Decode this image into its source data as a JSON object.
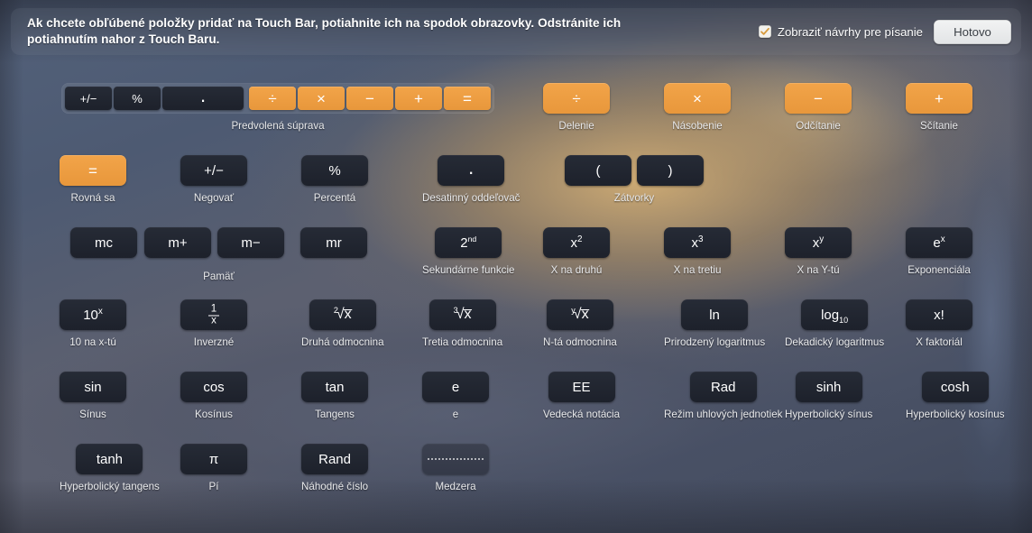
{
  "header": {
    "instruction": "Ak chcete obľúbené položky pridať na Touch Bar, potiahnite ich na spodok obrazovky. Odstránite ich potiahnutím nahor z Touch Baru.",
    "checkbox_label": "Zobraziť návrhy pre písanie",
    "checkbox_checked": true,
    "done_label": "Hotovo"
  },
  "colors": {
    "accent_orange": "#ee9d41",
    "key_dark": "#20252f",
    "caption": "#e9eaec",
    "panel": "rgba(255,255,255,0.055)"
  },
  "default_set": {
    "caption": "Predvolená súprava",
    "dark_keys": [
      {
        "glyph": "+/−",
        "name": "negate"
      },
      {
        "glyph": "%",
        "name": "percent"
      },
      {
        "glyph": ".",
        "name": "decimal-separator"
      }
    ],
    "orange_keys": [
      {
        "glyph": "÷",
        "name": "divide"
      },
      {
        "glyph": "×",
        "name": "multiply"
      },
      {
        "glyph": "−",
        "name": "subtract"
      },
      {
        "glyph": "+",
        "name": "add"
      },
      {
        "glyph": "=",
        "name": "equals"
      }
    ]
  },
  "rows": [
    {
      "id": "row-1",
      "items": [
        {
          "type": "tray",
          "name": "default-set",
          "caption": "Predvolená súprava"
        },
        {
          "type": "key",
          "name": "divide",
          "glyph": "÷",
          "caption": "Delenie",
          "style": "orange"
        },
        {
          "type": "key",
          "name": "multiply",
          "glyph": "×",
          "caption": "Násobenie",
          "style": "orange"
        },
        {
          "type": "key",
          "name": "subtract",
          "glyph": "−",
          "caption": "Odčítanie",
          "style": "orange"
        },
        {
          "type": "key",
          "name": "add",
          "glyph": "+",
          "caption": "Sčítanie",
          "style": "orange"
        }
      ]
    },
    {
      "id": "row-2",
      "items": [
        {
          "type": "key",
          "name": "equals",
          "glyph": "=",
          "caption": "Rovná sa",
          "style": "orange"
        },
        {
          "type": "key",
          "name": "negate",
          "glyph": "+/−",
          "caption": "Negovať",
          "style": "dark"
        },
        {
          "type": "key",
          "name": "percent",
          "glyph": "%",
          "caption": "Percentá",
          "style": "dark"
        },
        {
          "type": "key",
          "name": "decimal-separator",
          "glyph": ".",
          "caption": "Desatinný oddeľovač",
          "style": "dark"
        },
        {
          "type": "pair",
          "name": "parentheses",
          "glyphs": [
            "(",
            ")"
          ],
          "caption": "Zátvorky",
          "style": "dark"
        }
      ]
    },
    {
      "id": "row-3",
      "items": [
        {
          "type": "key",
          "name": "memory-clear",
          "glyph": "mc",
          "caption": "",
          "style": "dark"
        },
        {
          "type": "key",
          "name": "memory-add",
          "glyph": "m+",
          "caption": "",
          "style": "dark"
        },
        {
          "type": "key",
          "name": "memory-subtract",
          "glyph": "m−",
          "caption": "",
          "style": "dark"
        },
        {
          "type": "key",
          "name": "memory-recall",
          "glyph": "mr",
          "caption": "",
          "style": "dark"
        },
        {
          "type": "key",
          "name": "second-functions",
          "glyph": "2nd",
          "caption": "Sekundárne funkcie",
          "style": "dark"
        },
        {
          "type": "key",
          "name": "x-squared",
          "glyph": "x²",
          "caption": "X na druhú",
          "style": "dark"
        },
        {
          "type": "key",
          "name": "x-cubed",
          "glyph": "x³",
          "caption": "X na tretiu",
          "style": "dark"
        },
        {
          "type": "key",
          "name": "x-to-the-y",
          "glyph": "xʸ",
          "caption": "X na Y-tú",
          "style": "dark"
        },
        {
          "type": "key",
          "name": "exponential",
          "glyph": "eˣ",
          "caption": "Exponenciála",
          "style": "dark"
        }
      ],
      "memory_caption": "Pamäť"
    },
    {
      "id": "row-4",
      "items": [
        {
          "type": "key",
          "name": "ten-to-the-x",
          "glyph": "10ˣ",
          "caption": "10 na x-tú",
          "style": "dark"
        },
        {
          "type": "key",
          "name": "inverse",
          "glyph": "1/x",
          "caption": "Inverzné",
          "style": "dark"
        },
        {
          "type": "key",
          "name": "square-root",
          "glyph": "²√x",
          "caption": "Druhá odmocnina",
          "style": "dark"
        },
        {
          "type": "key",
          "name": "cube-root",
          "glyph": "³√x",
          "caption": "Tretia odmocnina",
          "style": "dark"
        },
        {
          "type": "key",
          "name": "nth-root",
          "glyph": "ʸ√x",
          "caption": "N-tá odmocnina",
          "style": "dark"
        },
        {
          "type": "key",
          "name": "natural-log",
          "glyph": "ln",
          "caption": "Prirodzený logaritmus",
          "style": "dark"
        },
        {
          "type": "key",
          "name": "log-base-10",
          "glyph": "log₁₀",
          "caption": "Dekadický logaritmus",
          "style": "dark"
        },
        {
          "type": "key",
          "name": "factorial",
          "glyph": "x!",
          "caption": "X faktoriál",
          "style": "dark"
        }
      ]
    },
    {
      "id": "row-5",
      "items": [
        {
          "type": "key",
          "name": "sine",
          "glyph": "sin",
          "caption": "Sínus",
          "style": "dark"
        },
        {
          "type": "key",
          "name": "cosine",
          "glyph": "cos",
          "caption": "Kosínus",
          "style": "dark"
        },
        {
          "type": "key",
          "name": "tangent",
          "glyph": "tan",
          "caption": "Tangens",
          "style": "dark"
        },
        {
          "type": "key",
          "name": "euler-e",
          "glyph": "e",
          "caption": "e",
          "style": "dark"
        },
        {
          "type": "key",
          "name": "scientific-notation",
          "glyph": "EE",
          "caption": "Vedecká notácia",
          "style": "dark"
        },
        {
          "type": "key",
          "name": "angle-unit-mode",
          "glyph": "Rad",
          "caption": "Režim uhlových jednotiek",
          "style": "dark"
        },
        {
          "type": "key",
          "name": "hyperbolic-sine",
          "glyph": "sinh",
          "caption": "Hyperbolický sínus",
          "style": "dark"
        },
        {
          "type": "key",
          "name": "hyperbolic-cosine",
          "glyph": "cosh",
          "caption": "Hyperbolický kosínus",
          "style": "dark"
        }
      ]
    },
    {
      "id": "row-6",
      "items": [
        {
          "type": "key",
          "name": "hyperbolic-tangent",
          "glyph": "tanh",
          "caption": "Hyperbolický tangens",
          "style": "dark"
        },
        {
          "type": "key",
          "name": "pi",
          "glyph": "π",
          "caption": "Pí",
          "style": "dark"
        },
        {
          "type": "key",
          "name": "random-number",
          "glyph": "Rand",
          "caption": "Náhodné číslo",
          "style": "dark"
        },
        {
          "type": "key",
          "name": "space",
          "glyph": "",
          "caption": "Medzera",
          "style": "dark"
        }
      ]
    }
  ]
}
